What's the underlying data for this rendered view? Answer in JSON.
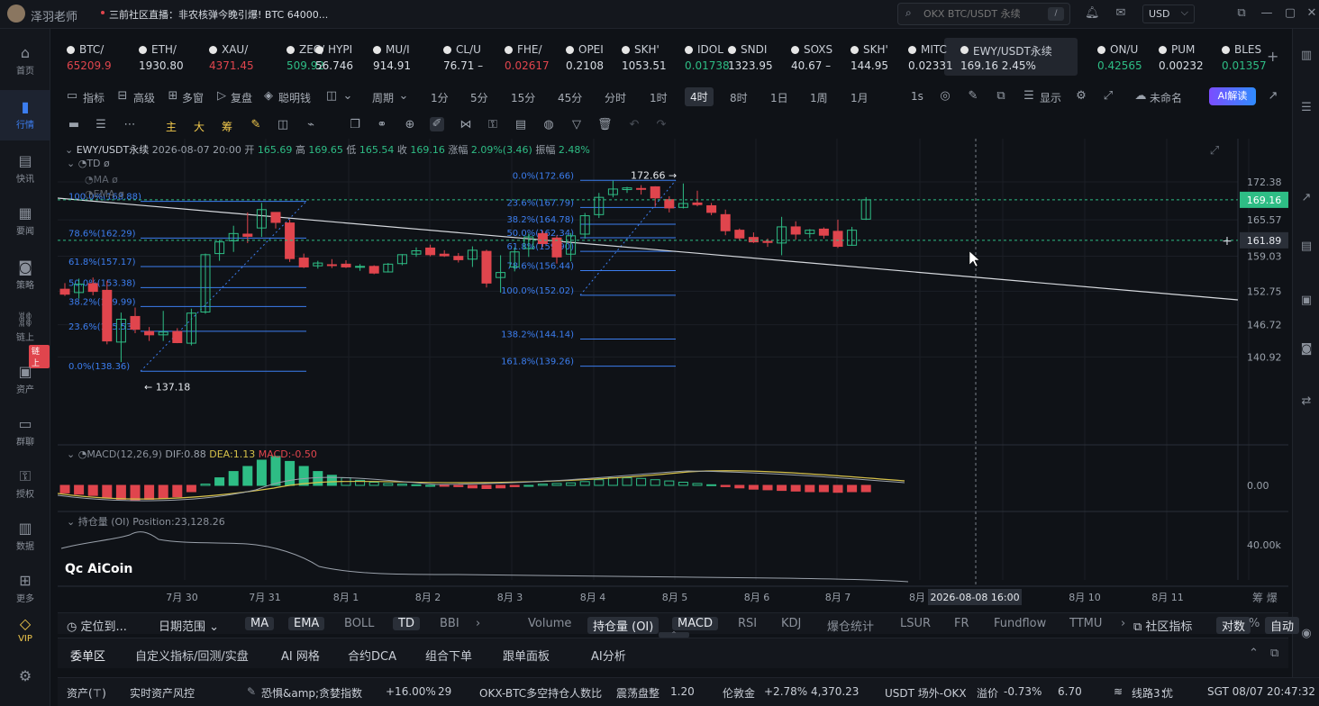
{
  "top": {
    "username": "泽羽老师",
    "news": "三前社区直播：非农核弹今晚引爆! BTC 64000...",
    "search_placeholder": "OKX BTC/USDT 永续",
    "search_kbd": "/",
    "currency": "USD",
    "currency_caret": "⌵"
  },
  "sidebar": {
    "items": [
      {
        "label": "首页",
        "icon": "home-icon",
        "glyph": "⌂"
      },
      {
        "label": "行情",
        "icon": "chart-bars-icon",
        "glyph": "▮"
      },
      {
        "label": "快讯",
        "icon": "news-icon",
        "glyph": "▤"
      },
      {
        "label": "要闻",
        "icon": "document-icon",
        "glyph": "▦"
      },
      {
        "label": "策略",
        "icon": "robot-icon",
        "glyph": "◙"
      },
      {
        "label": "链上",
        "icon": "chain-icon",
        "glyph": "⛓"
      },
      {
        "label": "资产",
        "icon": "wallet-icon",
        "glyph": "▣"
      },
      {
        "label": "群聊",
        "icon": "chat-icon",
        "glyph": "▭"
      },
      {
        "label": "授权",
        "icon": "key-icon",
        "glyph": "⚿"
      },
      {
        "label": "数据",
        "icon": "data-icon",
        "glyph": "▥"
      },
      {
        "label": "更多",
        "icon": "grid-icon",
        "glyph": "⊞"
      }
    ],
    "badge": "链上",
    "vip": "VIP",
    "settings_glyph": "⚙"
  },
  "tickers": [
    {
      "name": "BTC/",
      "price": "65209.9",
      "color": "dn"
    },
    {
      "name": "ETH/",
      "price": "1930.80",
      "color": "wh"
    },
    {
      "name": "XAU/",
      "price": "4371.45",
      "color": "dn"
    },
    {
      "name": "ZEC/",
      "price": "509.92",
      "color": "up"
    },
    {
      "name": "HYPI",
      "price": "56.746",
      "color": "wh"
    },
    {
      "name": "MU/I",
      "price": "914.91",
      "color": "wh"
    },
    {
      "name": "CL/U",
      "price": "76.71 –",
      "color": "wh"
    },
    {
      "name": "FHE/",
      "price": "0.02617",
      "color": "dn"
    },
    {
      "name": "OPEI",
      "price": "0.2108",
      "color": "wh"
    },
    {
      "name": "SKH'",
      "price": "1053.51",
      "color": "wh"
    },
    {
      "name": "IDOL",
      "price": "0.01738",
      "color": "up"
    },
    {
      "name": "SNDI",
      "price": "1323.95",
      "color": "wh"
    },
    {
      "name": "SOXS",
      "price": "40.67 –",
      "color": "wh"
    },
    {
      "name": "SKH'",
      "price": "144.95",
      "color": "wh"
    },
    {
      "name": "MITC",
      "price": "0.02331",
      "color": "wh"
    },
    {
      "name": "EWY/USDT永续",
      "price": "169.16  2.45%",
      "color": "wh"
    },
    {
      "name": "ON/U",
      "price": "0.42565",
      "color": "up"
    },
    {
      "name": "PUM",
      "price": "0.00232",
      "color": "wh"
    },
    {
      "name": "BLES",
      "price": "0.01357",
      "color": "up"
    }
  ],
  "toolbar": {
    "indicators": "指标",
    "advanced": "高级",
    "multi": "多窗",
    "replay": "复盘",
    "smart": "聪明钱",
    "period": "周期",
    "periods": [
      "1分",
      "5分",
      "15分",
      "45分",
      "分时",
      "1时",
      "4时",
      "8时",
      "1日",
      "1周",
      "1月"
    ],
    "selected_period": "4时",
    "interval": "1s",
    "display": "显示",
    "unnamed": "未命名",
    "ai": "AI解读"
  },
  "drawtools": {
    "main": "主",
    "big": "大",
    "chips": "筹"
  },
  "chart": {
    "symbol": "EWY/USDT永续",
    "datetime": "2026-08-07 20:00",
    "open_label": "开",
    "open": "165.69",
    "high_label": "高",
    "high": "169.65",
    "low_label": "低",
    "low": "165.54",
    "close_label": "收",
    "close": "169.16",
    "change_label": "涨幅",
    "change": "2.09%(3.46)",
    "amp_label": "振幅",
    "amp": "2.48%",
    "overlays": [
      "TD",
      "MA",
      "EMA"
    ],
    "macd_label": "MACD(12,26,9)",
    "dif": "DIF:0.88",
    "dea": "DEA:1.13",
    "macd": "MACD:-0.50",
    "oi_label": "持仓量 (OI)",
    "oi_value": "Position:23,128.26",
    "watermark": "AiCoin",
    "crosshair_time": "2026-08-08 16:00",
    "current_price": "169.16",
    "crosshair_price": "161.89",
    "high_marker": "172.66",
    "low_marker": "137.18",
    "macd_zero": "0.00",
    "oi_tick": "40.00k"
  },
  "chart_data": {
    "type": "candlestick",
    "price_axis_ticks": [
      172.38,
      165.57,
      159.03,
      152.75,
      146.72,
      140.92
    ],
    "x_ticks": [
      "7月 30",
      "7月 31",
      "8月 1",
      "8月 2",
      "8月 3",
      "8月 4",
      "8月 5",
      "8月 6",
      "8月 7",
      "8月",
      "8月 10",
      "8月 11"
    ],
    "candles": [
      {
        "o": 153.1,
        "h": 154.2,
        "l": 151.9,
        "c": 152.2
      },
      {
        "o": 152.5,
        "h": 155.0,
        "l": 151.4,
        "c": 154.0
      },
      {
        "o": 154.1,
        "h": 155.2,
        "l": 152.0,
        "c": 152.7
      },
      {
        "o": 152.9,
        "h": 154.6,
        "l": 143.2,
        "c": 143.8
      },
      {
        "o": 143.6,
        "h": 148.9,
        "l": 140.0,
        "c": 147.7
      },
      {
        "o": 148.2,
        "h": 149.8,
        "l": 145.2,
        "c": 145.9
      },
      {
        "o": 145.5,
        "h": 146.3,
        "l": 143.8,
        "c": 144.9
      },
      {
        "o": 144.9,
        "h": 149.2,
        "l": 143.8,
        "c": 145.4
      },
      {
        "o": 145.5,
        "h": 146.1,
        "l": 143.4,
        "c": 143.5
      },
      {
        "o": 143.4,
        "h": 149.6,
        "l": 143.0,
        "c": 148.8
      },
      {
        "o": 149.0,
        "h": 159.5,
        "l": 148.7,
        "c": 159.3
      },
      {
        "o": 159.5,
        "h": 162.0,
        "l": 158.2,
        "c": 161.6
      },
      {
        "o": 161.8,
        "h": 164.5,
        "l": 159.8,
        "c": 163.1
      },
      {
        "o": 163.0,
        "h": 166.9,
        "l": 161.4,
        "c": 162.6
      },
      {
        "o": 164.1,
        "h": 168.6,
        "l": 162.5,
        "c": 167.4
      },
      {
        "o": 166.9,
        "h": 166.6,
        "l": 164.0,
        "c": 165.1
      },
      {
        "o": 165.0,
        "h": 165.6,
        "l": 158.0,
        "c": 158.6
      },
      {
        "o": 158.7,
        "h": 159.5,
        "l": 156.9,
        "c": 157.1
      },
      {
        "o": 157.3,
        "h": 158.2,
        "l": 156.8,
        "c": 157.8
      },
      {
        "o": 157.5,
        "h": 158.5,
        "l": 156.9,
        "c": 157.4
      },
      {
        "o": 157.6,
        "h": 158.3,
        "l": 156.9,
        "c": 157.1
      },
      {
        "o": 157.1,
        "h": 157.6,
        "l": 156.4,
        "c": 157.2
      },
      {
        "o": 157.2,
        "h": 157.4,
        "l": 155.8,
        "c": 156.0
      },
      {
        "o": 156.2,
        "h": 157.8,
        "l": 156.1,
        "c": 157.6
      },
      {
        "o": 157.7,
        "h": 159.4,
        "l": 157.4,
        "c": 159.3
      },
      {
        "o": 159.4,
        "h": 160.6,
        "l": 158.9,
        "c": 160.0
      },
      {
        "o": 160.5,
        "h": 161.1,
        "l": 159.0,
        "c": 159.3
      },
      {
        "o": 159.4,
        "h": 160.1,
        "l": 158.9,
        "c": 159.1
      },
      {
        "o": 159.0,
        "h": 159.6,
        "l": 157.9,
        "c": 158.4
      },
      {
        "o": 158.5,
        "h": 160.8,
        "l": 157.1,
        "c": 160.1
      },
      {
        "o": 159.9,
        "h": 160.2,
        "l": 153.4,
        "c": 154.2
      },
      {
        "o": 155.2,
        "h": 159.2,
        "l": 152.5,
        "c": 156.1
      },
      {
        "o": 157.1,
        "h": 160.6,
        "l": 156.3,
        "c": 159.8
      },
      {
        "o": 160.4,
        "h": 163.1,
        "l": 158.9,
        "c": 162.5
      },
      {
        "o": 163.1,
        "h": 163.6,
        "l": 160.7,
        "c": 161.3
      },
      {
        "o": 162.3,
        "h": 162.8,
        "l": 157.7,
        "c": 158.9
      },
      {
        "o": 159.4,
        "h": 163.2,
        "l": 158.1,
        "c": 162.7
      },
      {
        "o": 163.0,
        "h": 166.8,
        "l": 162.2,
        "c": 166.3
      },
      {
        "o": 166.5,
        "h": 170.4,
        "l": 165.9,
        "c": 169.6
      },
      {
        "o": 170.1,
        "h": 172.6,
        "l": 169.6,
        "c": 171.1
      },
      {
        "o": 171.0,
        "h": 171.5,
        "l": 170.4,
        "c": 171.3
      },
      {
        "o": 171.2,
        "h": 171.8,
        "l": 170.1,
        "c": 171.1
      },
      {
        "o": 171.5,
        "h": 171.6,
        "l": 167.9,
        "c": 169.5
      },
      {
        "o": 169.2,
        "h": 169.8,
        "l": 166.9,
        "c": 167.7
      },
      {
        "o": 167.8,
        "h": 172.1,
        "l": 167.6,
        "c": 168.5
      },
      {
        "o": 168.6,
        "h": 170.8,
        "l": 168.0,
        "c": 168.3
      },
      {
        "o": 168.1,
        "h": 168.6,
        "l": 166.4,
        "c": 166.9
      },
      {
        "o": 166.5,
        "h": 167.4,
        "l": 162.8,
        "c": 163.6
      },
      {
        "o": 163.7,
        "h": 164.0,
        "l": 161.9,
        "c": 162.3
      },
      {
        "o": 162.4,
        "h": 163.3,
        "l": 161.4,
        "c": 161.6
      },
      {
        "o": 161.7,
        "h": 162.2,
        "l": 160.7,
        "c": 161.5
      },
      {
        "o": 161.4,
        "h": 166.1,
        "l": 159.2,
        "c": 164.3
      },
      {
        "o": 164.3,
        "h": 165.3,
        "l": 162.0,
        "c": 163.0
      },
      {
        "o": 163.1,
        "h": 163.9,
        "l": 162.3,
        "c": 163.7
      },
      {
        "o": 163.9,
        "h": 164.2,
        "l": 162.2,
        "c": 162.8
      },
      {
        "o": 163.5,
        "h": 165.6,
        "l": 160.5,
        "c": 160.8
      },
      {
        "o": 161.0,
        "h": 164.3,
        "l": 160.9,
        "c": 163.7
      },
      {
        "o": 165.69,
        "h": 169.65,
        "l": 165.54,
        "c": 169.16
      }
    ],
    "fib_left": [
      {
        "pct": "100.0%",
        "price": "168.88"
      },
      {
        "pct": "78.6%",
        "price": "162.29"
      },
      {
        "pct": "61.8%",
        "price": "157.17"
      },
      {
        "pct": "50.0%",
        "price": "153.38"
      },
      {
        "pct": "38.2%",
        "price": "149.99"
      },
      {
        "pct": "23.6%",
        "price": "145.53"
      },
      {
        "pct": "0.0%",
        "price": "138.36"
      }
    ],
    "fib_right": [
      {
        "pct": "0.0%",
        "price": "172.66"
      },
      {
        "pct": "23.6%",
        "price": "167.79"
      },
      {
        "pct": "38.2%",
        "price": "164.78"
      },
      {
        "pct": "50.0%",
        "price": "162.34"
      },
      {
        "pct": "61.8%",
        "price": "159.90"
      },
      {
        "pct": "78.6%",
        "price": "156.44"
      },
      {
        "pct": "100.0%",
        "price": "152.02"
      },
      {
        "pct": "138.2%",
        "price": "144.14"
      },
      {
        "pct": "161.8%",
        "price": "139.26"
      }
    ],
    "macd_hist": [
      -0.6,
      -0.7,
      -0.8,
      -1.0,
      -1.1,
      -1.2,
      -1.1,
      -1.0,
      -0.9,
      -0.5,
      0.1,
      0.6,
      1.1,
      1.5,
      2.0,
      2.3,
      1.9,
      1.5,
      1.1,
      0.8,
      0.6,
      0.4,
      0.25,
      0.15,
      0.1,
      0.05,
      0.0,
      -0.05,
      -0.1,
      -0.2,
      -0.25,
      -0.2,
      -0.1,
      0.0,
      0.1,
      0.15,
      0.2,
      0.3,
      0.45,
      0.6,
      0.6,
      0.55,
      0.45,
      0.35,
      0.25,
      0.15,
      0.05,
      -0.1,
      -0.2,
      -0.3,
      -0.35,
      -0.4,
      -0.45,
      -0.5,
      -0.5,
      -0.55,
      -0.5,
      -0.5
    ],
    "colors": {
      "up": "#2ebd85",
      "down": "#e0454d",
      "fib": "#3c7ef0",
      "dif": "#9aa1ab",
      "dea": "#d6c14a"
    }
  },
  "indicator_bar": {
    "locate": "定位到...",
    "date_range": "日期范围",
    "overlays": [
      "MA",
      "EMA",
      "BOLL",
      "TD",
      "BBI"
    ],
    "sub": [
      "Volume",
      "持仓量 (OI)",
      "MACD",
      "RSI",
      "KDJ",
      "爆仓统计",
      "LSUR",
      "FR",
      "Fundflow",
      "TTMU"
    ],
    "community": "社区指标",
    "log": "对数",
    "pct": "%",
    "auto": "自动",
    "filter": "筹 爆"
  },
  "orders": {
    "tabs": [
      "委单区",
      "自定义指标/回测/实盘",
      "AI 网格",
      "合约DCA",
      "组合下单",
      "跟单面板",
      "AI分析"
    ]
  },
  "status": {
    "assets": "资产(⊤)",
    "risk": "实时资产风控",
    "fear": "恐惧&amp;贪婪指数",
    "fear_change": "+16.00%",
    "fear_value": "29",
    "okx": "OKX-BTC多空持仓人数比",
    "okx_state": "震荡盘整",
    "okx_value": "1.20",
    "gold": "伦敦金",
    "gold_change": "+2.78%",
    "gold_value": "4,370.23",
    "usdt": "USDT 场外-OKX",
    "premium": "溢价",
    "premium_change": "-0.73%",
    "premium_value": "6.70",
    "line": "线路3：",
    "line_state": "优",
    "time": "SGT 08/07 20:47:32"
  }
}
